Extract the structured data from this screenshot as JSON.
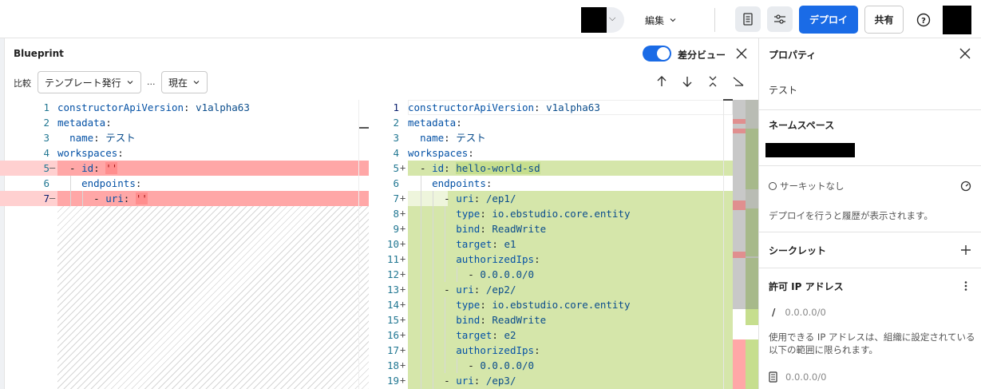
{
  "topbar": {
    "edit_label": "編集",
    "deploy_label": "デプロイ",
    "share_label": "共有",
    "help_glyph": "?"
  },
  "blueprint": {
    "title": "Blueprint",
    "diff_view_label": "差分ビュー",
    "diff_view_on": true,
    "compare_label": "比較",
    "left_select": "テンプレート発行",
    "ellipsis": "...",
    "right_select": "現在"
  },
  "left_code": {
    "numbers": [
      "1",
      "2",
      "3",
      "4",
      "5",
      "6",
      "7"
    ],
    "markers": [
      "",
      "",
      "",
      "",
      "—",
      "",
      "—"
    ]
  },
  "right_code": {
    "numbers": [
      "1",
      "2",
      "3",
      "4",
      "5",
      "6",
      "7",
      "8",
      "9",
      "10",
      "11",
      "12",
      "13",
      "14",
      "15",
      "16",
      "17",
      "18",
      "19"
    ],
    "markers": [
      "",
      "",
      "",
      "",
      "+",
      "",
      "+",
      "+",
      "+",
      "+",
      "+",
      "+",
      "+",
      "+",
      "+",
      "+",
      "+",
      "+",
      "+"
    ]
  },
  "code_text": {
    "constructorApiVersion": "constructorApiVersion",
    "version_value": "v1alpha63",
    "metadata": "metadata",
    "name": "name",
    "name_value": "テスト",
    "workspaces": "workspaces",
    "id": "id",
    "empty_string": "''",
    "id_value": "hello-world-sd",
    "endpoints": "endpoints",
    "uri": "uri",
    "ep1": "/ep1/",
    "ep2": "/ep2/",
    "ep3": "/ep3/",
    "type": "type",
    "type_value": "io.ebstudio.core.entity",
    "bind": "bind",
    "bind_value": "ReadWrite",
    "target": "target",
    "e1": "e1",
    "e2": "e2",
    "authorizedIps": "authorizedIps",
    "ip_value": "0.0.0.0/0"
  },
  "properties": {
    "title": "プロパティ",
    "name_value": "テスト",
    "namespace_label": "ネームスペース",
    "circuit_label": "サーキットなし",
    "deploy_history_note": "デプロイを行うと履歴が表示されます。",
    "secrets_label": "シークレット",
    "allowed_ip_label": "許可 IP アドレス",
    "ip_placeholder": "0.0.0.0/0",
    "ip_note": "使用できる IP アドレスは、組織に設定されている以下の範囲に限られます。",
    "ip_range": "0.0.0.0/0"
  },
  "colors": {
    "accent": "#1a6be6",
    "deleted": "#ffa7a7",
    "added": "#d5e6aa"
  }
}
